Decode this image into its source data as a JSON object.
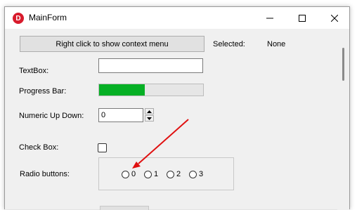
{
  "window": {
    "title": "MainForm",
    "icon_letter": "D",
    "icon_color": "#d81b2c",
    "controls": [
      "minimize-icon",
      "maximize-icon",
      "close-icon"
    ]
  },
  "context_button": {
    "label": "Right click to show context menu"
  },
  "selected": {
    "label": "Selected:",
    "value": "None"
  },
  "textbox": {
    "label": "TextBox:",
    "value": ""
  },
  "progress": {
    "label": "Progress Bar:",
    "fraction": 0.44,
    "fill_color": "#06b025"
  },
  "numeric": {
    "label": "Numeric Up Down:",
    "value": "0",
    "up_icon": "caret-up-icon",
    "down_icon": "caret-down-icon"
  },
  "checkbox": {
    "label": "Check Box:",
    "checked": false
  },
  "radio": {
    "label": "Radio buttons:",
    "options": [
      "0",
      "1",
      "2",
      "3"
    ]
  },
  "annotation": {
    "arrow_color": "#e01010"
  }
}
